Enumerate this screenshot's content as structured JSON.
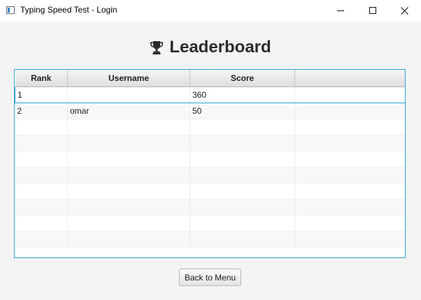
{
  "window": {
    "title": "Typing Speed Test - Login",
    "controls": [
      "minimize",
      "maximize",
      "close"
    ]
  },
  "page": {
    "title": "Leaderboard",
    "title_icon": "trophy-icon"
  },
  "leaderboard": {
    "columns": [
      "Rank",
      "Username",
      "Score",
      ""
    ],
    "rows": [
      {
        "rank": "1",
        "username": "",
        "score": "360"
      },
      {
        "rank": "2",
        "username": "omar",
        "score": "50"
      }
    ],
    "selected_row": 0,
    "empty_rows": 8
  },
  "actions": {
    "back_label": "Back to Menu"
  },
  "colors": {
    "accent": "#2aa3d6",
    "header_bg": "#e4e4e4",
    "page_bg": "#f4f4f4"
  }
}
